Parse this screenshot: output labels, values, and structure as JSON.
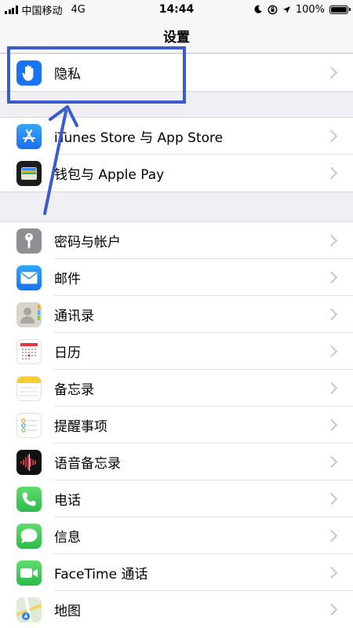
{
  "status_bar": {
    "carrier": "中国移动",
    "network": "4G",
    "time": "14:44",
    "battery_percent": "100%",
    "battery_level": 1.0
  },
  "nav": {
    "title": "设置"
  },
  "groups": [
    {
      "items": [
        {
          "label": "隐私",
          "icon": "hand-icon",
          "color": "#1a73f0"
        }
      ]
    },
    {
      "items": [
        {
          "label": "iTunes Store 与 App Store",
          "icon": "app-store-icon",
          "color": "#2f8ef3"
        },
        {
          "label": "钱包与 Apple Pay",
          "icon": "wallet-icon",
          "color": "#1c1c1e"
        }
      ]
    },
    {
      "items": [
        {
          "label": "密码与帐户",
          "icon": "key-icon",
          "color": "#8e8e93"
        },
        {
          "label": "邮件",
          "icon": "mail-icon",
          "color": "#1a8cf5"
        },
        {
          "label": "通讯录",
          "icon": "contacts-icon",
          "color": "#c9c6bf"
        },
        {
          "label": "日历",
          "icon": "calendar-icon",
          "color": "#ffffff"
        },
        {
          "label": "备忘录",
          "icon": "notes-icon",
          "color": "#ffffff"
        },
        {
          "label": "提醒事项",
          "icon": "reminders-icon",
          "color": "#ffffff"
        },
        {
          "label": "语音备忘录",
          "icon": "voice-memos-icon",
          "color": "#111111"
        },
        {
          "label": "电话",
          "icon": "phone-icon",
          "color": "#34c759"
        },
        {
          "label": "信息",
          "icon": "messages-icon",
          "color": "#34c759"
        },
        {
          "label": "FaceTime 通话",
          "icon": "facetime-icon",
          "color": "#34c759"
        },
        {
          "label": "地图",
          "icon": "maps-icon",
          "color": "#d9e8d0"
        }
      ]
    }
  ],
  "annotation": {
    "color": "#3a5ccc"
  }
}
